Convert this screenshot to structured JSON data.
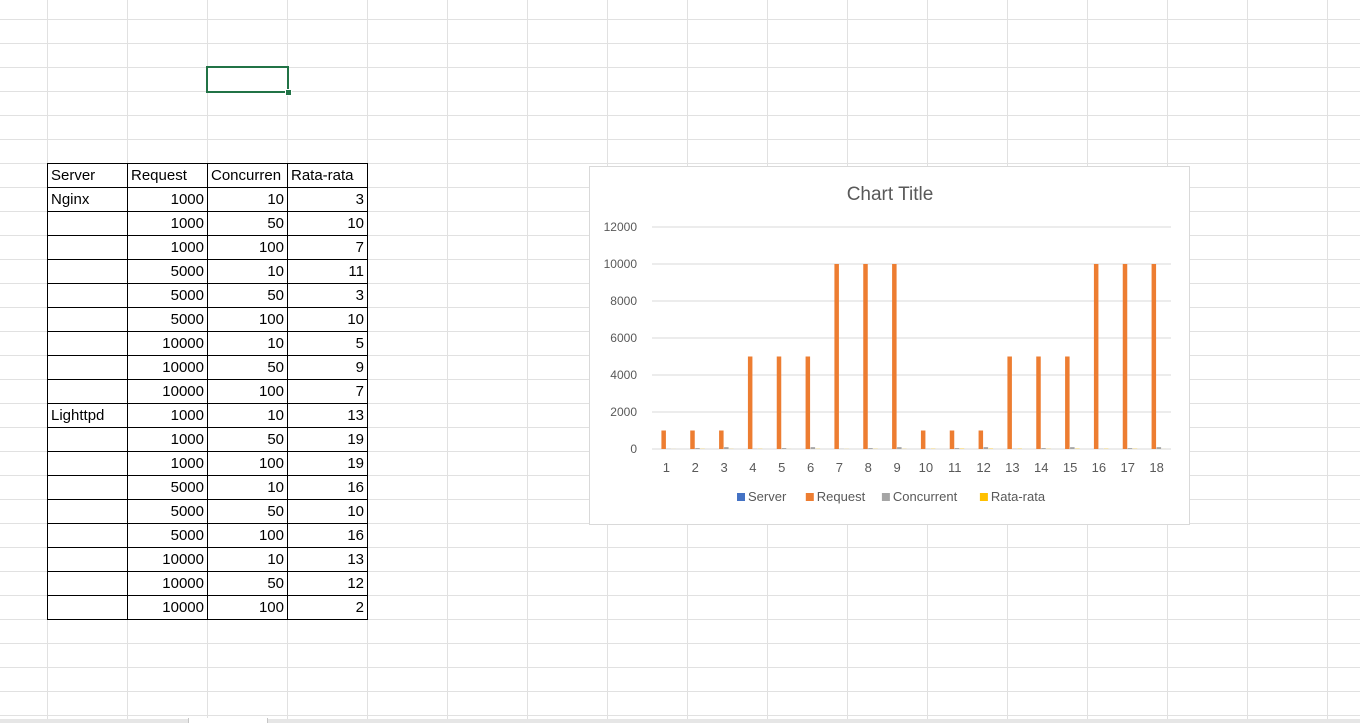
{
  "table": {
    "headers": [
      "Server",
      "Request",
      "Concurren",
      "Rata-rata"
    ],
    "rows": [
      [
        "Nginx",
        1000,
        10,
        3
      ],
      [
        "",
        1000,
        50,
        10
      ],
      [
        "",
        1000,
        100,
        7
      ],
      [
        "",
        5000,
        10,
        11
      ],
      [
        "",
        5000,
        50,
        3
      ],
      [
        "",
        5000,
        100,
        10
      ],
      [
        "",
        10000,
        10,
        5
      ],
      [
        "",
        10000,
        50,
        9
      ],
      [
        "",
        10000,
        100,
        7
      ],
      [
        "Lighttpd",
        1000,
        10,
        13
      ],
      [
        "",
        1000,
        50,
        19
      ],
      [
        "",
        1000,
        100,
        19
      ],
      [
        "",
        5000,
        10,
        16
      ],
      [
        "",
        5000,
        50,
        10
      ],
      [
        "",
        5000,
        100,
        16
      ],
      [
        "",
        10000,
        10,
        13
      ],
      [
        "",
        10000,
        50,
        12
      ],
      [
        "",
        10000,
        100,
        2
      ]
    ]
  },
  "colors": {
    "grid": "#e1e1e1",
    "selection": "#217346",
    "chart_grid": "#d9d9d9",
    "axis_text": "#595959"
  },
  "chart_data": {
    "type": "bar",
    "title": "Chart Title",
    "categories": [
      "1",
      "2",
      "3",
      "4",
      "5",
      "6",
      "7",
      "8",
      "9",
      "10",
      "11",
      "12",
      "13",
      "14",
      "15",
      "16",
      "17",
      "18"
    ],
    "series": [
      {
        "name": "Server",
        "color": "#4472C4",
        "values": [
          0,
          0,
          0,
          0,
          0,
          0,
          0,
          0,
          0,
          0,
          0,
          0,
          0,
          0,
          0,
          0,
          0,
          0
        ]
      },
      {
        "name": "Request",
        "color": "#ED7D31",
        "values": [
          1000,
          1000,
          1000,
          5000,
          5000,
          5000,
          10000,
          10000,
          10000,
          1000,
          1000,
          1000,
          5000,
          5000,
          5000,
          10000,
          10000,
          10000
        ]
      },
      {
        "name": "Concurrent",
        "color": "#A5A5A5",
        "values": [
          10,
          50,
          100,
          10,
          50,
          100,
          10,
          50,
          100,
          10,
          50,
          100,
          10,
          50,
          100,
          10,
          50,
          100
        ]
      },
      {
        "name": "Rata-rata",
        "color": "#FFC000",
        "values": [
          3,
          10,
          7,
          11,
          3,
          10,
          5,
          9,
          7,
          13,
          19,
          19,
          16,
          10,
          16,
          13,
          12,
          2
        ]
      }
    ],
    "ylim": [
      0,
      12000
    ],
    "yticks": [
      0,
      2000,
      4000,
      6000,
      8000,
      10000,
      12000
    ],
    "grid": true,
    "legend": "bottom"
  }
}
